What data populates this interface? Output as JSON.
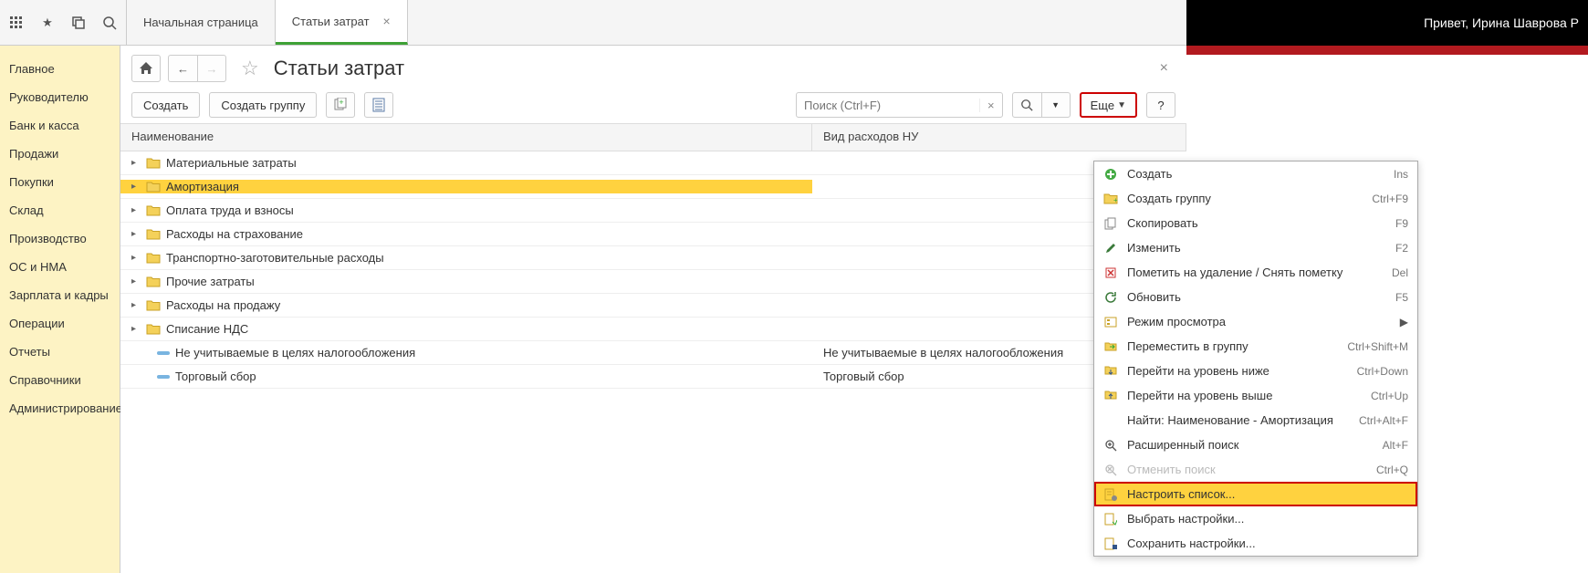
{
  "header_right": {
    "greeting": "Привет, Ирина Шаврова Р"
  },
  "tabs": {
    "home": "Начальная страница",
    "active": "Статьи затрат"
  },
  "sidebar": {
    "items": [
      "Главное",
      "Руководителю",
      "Банк и касса",
      "Продажи",
      "Покупки",
      "Склад",
      "Производство",
      "ОС и НМА",
      "Зарплата и кадры",
      "Операции",
      "Отчеты",
      "Справочники",
      "Администрирование"
    ]
  },
  "page": {
    "title": "Статьи затрат"
  },
  "toolbar": {
    "create": "Создать",
    "create_group": "Создать группу",
    "search_placeholder": "Поиск (Ctrl+F)",
    "more": "Еще"
  },
  "table": {
    "cols": {
      "name": "Наименование",
      "type": "Вид расходов НУ"
    },
    "rows": [
      {
        "kind": "folder",
        "name": "Материальные затраты",
        "type": ""
      },
      {
        "kind": "folder",
        "name": "Амортизация",
        "type": "",
        "selected": true
      },
      {
        "kind": "folder",
        "name": "Оплата труда и взносы",
        "type": ""
      },
      {
        "kind": "folder",
        "name": "Расходы на страхование",
        "type": ""
      },
      {
        "kind": "folder",
        "name": "Транспортно-заготовительные расходы",
        "type": ""
      },
      {
        "kind": "folder",
        "name": "Прочие затраты",
        "type": ""
      },
      {
        "kind": "folder",
        "name": "Расходы на продажу",
        "type": ""
      },
      {
        "kind": "folder",
        "name": "Списание НДС",
        "type": ""
      },
      {
        "kind": "item",
        "name": "Не учитываемые в целях налогообложения",
        "type": "Не учитываемые в целях налогообложения"
      },
      {
        "kind": "item",
        "name": "Торговый сбор",
        "type": "Торговый сбор"
      }
    ]
  },
  "menu": {
    "items": [
      {
        "icon": "plus-green",
        "label": "Создать",
        "shortcut": "Ins"
      },
      {
        "icon": "folder-plus",
        "label": "Создать группу",
        "shortcut": "Ctrl+F9"
      },
      {
        "icon": "copy",
        "label": "Скопировать",
        "shortcut": "F9"
      },
      {
        "icon": "pencil",
        "label": "Изменить",
        "shortcut": "F2"
      },
      {
        "icon": "delete-mark",
        "label": "Пометить на удаление / Снять пометку",
        "shortcut": "Del"
      },
      {
        "icon": "refresh",
        "label": "Обновить",
        "shortcut": "F5"
      },
      {
        "icon": "view",
        "label": "Режим просмотра",
        "submenu": true
      },
      {
        "icon": "move",
        "label": "Переместить в группу",
        "shortcut": "Ctrl+Shift+M"
      },
      {
        "icon": "level-down",
        "label": "Перейти на уровень ниже",
        "shortcut": "Ctrl+Down"
      },
      {
        "icon": "level-up",
        "label": "Перейти на уровень выше",
        "shortcut": "Ctrl+Up"
      },
      {
        "icon": "",
        "label": "Найти: Наименование - Амортизация",
        "shortcut": "Ctrl+Alt+F"
      },
      {
        "icon": "search-plus",
        "label": "Расширенный поиск",
        "shortcut": "Alt+F"
      },
      {
        "icon": "search-x",
        "label": "Отменить поиск",
        "shortcut": "Ctrl+Q",
        "disabled": true
      },
      {
        "icon": "list-gear",
        "label": "Настроить список...",
        "highlighted": true
      },
      {
        "icon": "list-pick",
        "label": "Выбрать настройки..."
      },
      {
        "icon": "list-save",
        "label": "Сохранить настройки..."
      }
    ]
  }
}
